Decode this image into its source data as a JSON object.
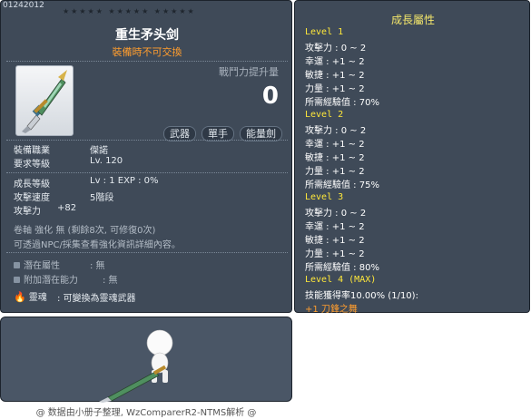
{
  "item": {
    "code": "01242012",
    "stars": "★★★★★  ★★★★★  ★★★★★",
    "name": "重生矛头剑",
    "trade_note": "裝備時不可交換",
    "power_label": "戰鬥力提升量",
    "power_value": "0",
    "tags": [
      "武器",
      "單手",
      "能量劍"
    ],
    "job_label": "裝備職業",
    "job_value": "傑諾",
    "req_level_label": "要求等級",
    "req_level_value": "Lv. 120",
    "growth_level_label": "成長等級",
    "growth_level_value": "Lv : 1   EXP : 0%",
    "attack_speed_label": "攻擊速度",
    "attack_speed_value": "5階段",
    "attack_label": "攻擊力",
    "attack_value": "+82",
    "scroll_line": "卷軸 強化 無 (剩餘8次, 可修復0次)",
    "npc_line": "可透過NPC/採集查看強化資訊詳細內容。",
    "potential_label": "潛在屬性",
    "potential_value": ":  無",
    "bonus_potential_label": "附加潛在能力",
    "bonus_potential_value": ":  無",
    "soul_label": "靈魂",
    "soul_value": ":  可變換為靈魂武器"
  },
  "growth": {
    "title": "成長屬性",
    "levels": [
      {
        "name": "Level 1",
        "lines": [
          "攻擊力 : 0 ~ 2",
          "幸運 : +1 ~ 2",
          "敏捷 : +1 ~ 2",
          "力量 : +1 ~ 2",
          "所需經驗值 : 70%"
        ]
      },
      {
        "name": "Level 2",
        "lines": [
          "攻擊力 : 0 ~ 2",
          "幸運 : +1 ~ 2",
          "敏捷 : +1 ~ 2",
          "力量 : +1 ~ 2",
          "所需經驗值 : 75%"
        ]
      },
      {
        "name": "Level 3",
        "lines": [
          "攻擊力 : 0 ~ 2",
          "幸運 : +1 ~ 2",
          "敏捷 : +1 ~ 2",
          "力量 : +1 ~ 2",
          "所需經驗值 : 80%"
        ]
      },
      {
        "name": "Level 4 (MAX)",
        "lines": [
          "技能獲得率10.00% (1/10):"
        ],
        "bonus": "+1 刀鋒之舞"
      }
    ]
  },
  "footer": "@ 数据由小册子整理, WzComparerR2-NTMS解析 @",
  "colors": {
    "panel": "#3f4a58",
    "accent_orange": "#ff9d2e",
    "level_yellow": "#ffe83a"
  }
}
